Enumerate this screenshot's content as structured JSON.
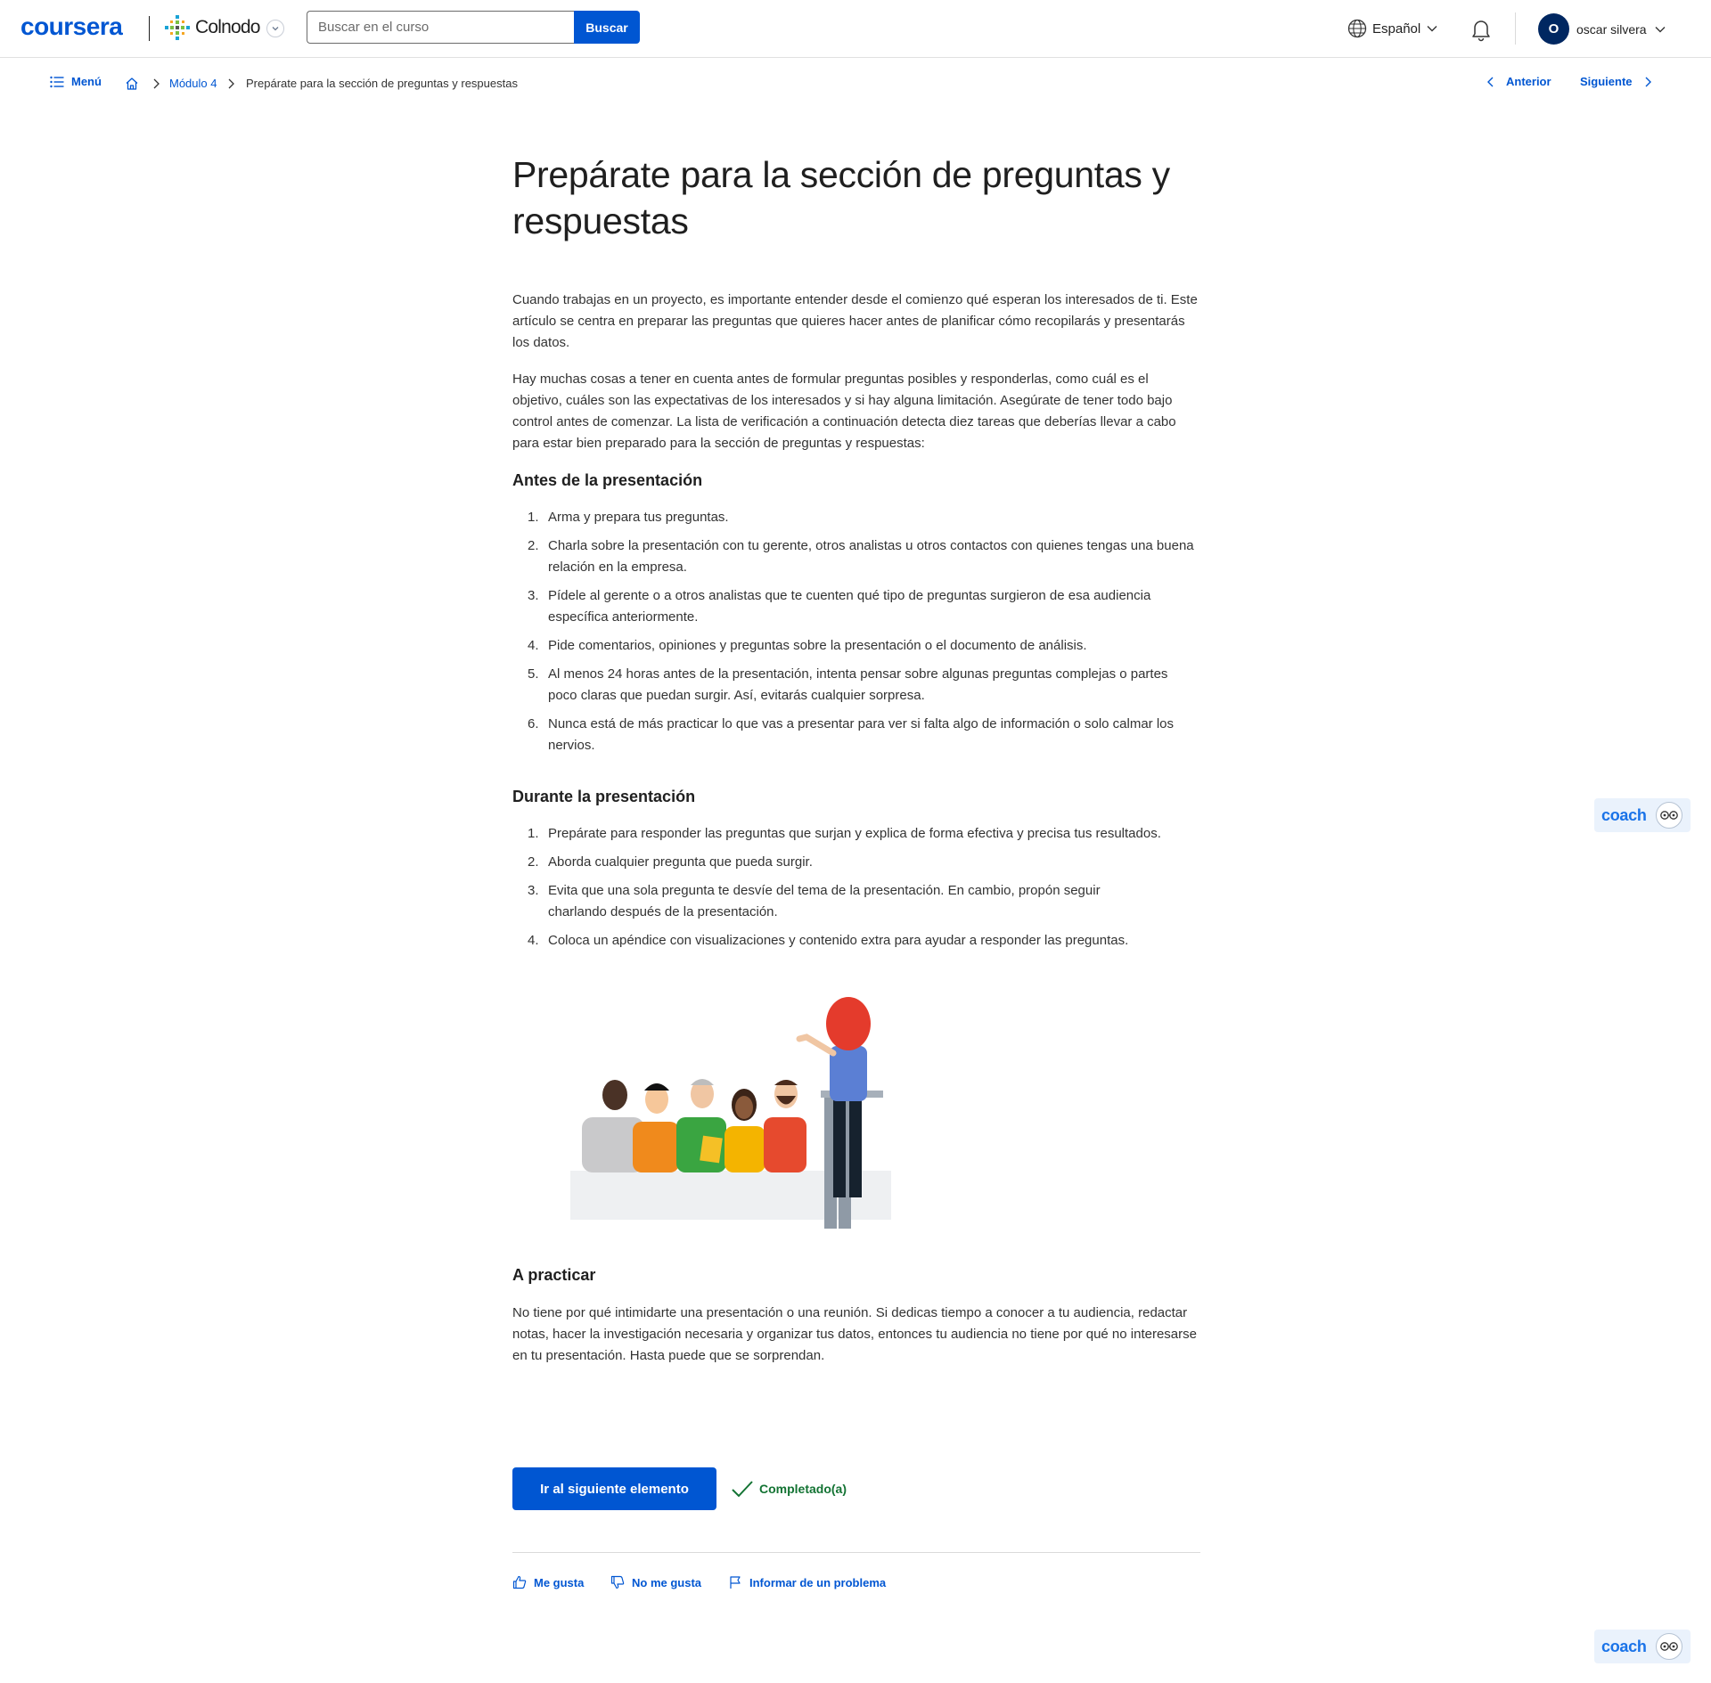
{
  "header": {
    "brand": "coursera",
    "partner": "Colnodo",
    "search": {
      "placeholder": "Buscar en el curso",
      "button": "Buscar"
    },
    "language": "Español",
    "user": {
      "initial": "O",
      "name": "oscar silvera"
    }
  },
  "breadcrumb": {
    "menu": "Menú",
    "module": "Módulo 4",
    "current": "Prepárate para la sección de preguntas y respuestas",
    "prev": "Anterior",
    "next": "Siguiente"
  },
  "article": {
    "title": "Prepárate para la sección de preguntas y respuestas",
    "intro": "Cuando trabajas en un proyecto, es importante entender desde el comienzo qué esperan los interesados de ti. Este artículo se centra en preparar las preguntas que quieres hacer antes de planificar cómo recopilarás y presentarás los datos.",
    "intro2": "Hay muchas cosas a tener en cuenta antes de formular preguntas posibles y responderlas, como cuál es el objetivo, cuáles son las expectativas de los interesados y si hay alguna limitación. Asegúrate de tener todo bajo control antes de comenzar. La lista de verificación a continuación detecta diez tareas que deberías llevar a cabo para estar bien preparado para la sección de preguntas y respuestas:",
    "before": {
      "heading": "Antes de la presentación",
      "items": [
        {
          "n": "1.",
          "text": "Arma y prepara tus preguntas."
        },
        {
          "n": "2.",
          "text": "Charla sobre la presentación con tu gerente, otros analistas u otros contactos con quienes tengas una buena relación en la empresa."
        },
        {
          "n": "3.",
          "text": "Pídele al gerente o a otros analistas que te cuenten qué tipo de preguntas surgieron de esa audiencia específica anteriormente."
        },
        {
          "n": "4.",
          "text": "Pide comentarios, opiniones y preguntas sobre la presentación o el documento de análisis."
        },
        {
          "n": "5.",
          "text": "Al menos 24 horas antes de la presentación, intenta pensar sobre algunas preguntas complejas o partes poco claras que puedan surgir. Así, evitarás cualquier sorpresa."
        },
        {
          "n": "6.",
          "text": "Nunca está de más practicar lo que vas a presentar para ver si falta algo de información o solo calmar los nervios."
        }
      ]
    },
    "during": {
      "heading": "Durante la presentación",
      "items": [
        {
          "n": "1.",
          "text": "Prepárate para responder las preguntas que surjan y explica de forma efectiva y precisa tus resultados."
        },
        {
          "n": "2.",
          "text": "Aborda cualquier pregunta que pueda surgir."
        },
        {
          "n": "3.",
          "text": "Evita que una sola pregunta te desvíe del tema de la presentación. En cambio, propón seguir  charlando después de la presentación."
        },
        {
          "n": "4.",
          "text": "Coloca un apéndice con visualizaciones y contenido extra para ayudar a responder las preguntas."
        }
      ]
    },
    "practice": {
      "heading": "A practicar",
      "text": "No tiene por qué intimidarte una presentación o una reunión. Si dedicas tiempo a conocer a tu audiencia, redactar notas, hacer la investigación necesaria y organizar tus datos, entonces tu audiencia no tiene por qué no interesarse en tu presentación. Hasta puede que se sorprendan."
    }
  },
  "actions": {
    "next_item": "Ir al siguiente elemento",
    "completed": "Completado(a)",
    "like": "Me gusta",
    "dislike": "No me gusta",
    "report": "Informar de un problema"
  },
  "coach": {
    "label": "coach"
  },
  "colors": {
    "brand": "#0056d2",
    "success": "#137333",
    "avatar": "#002761"
  }
}
